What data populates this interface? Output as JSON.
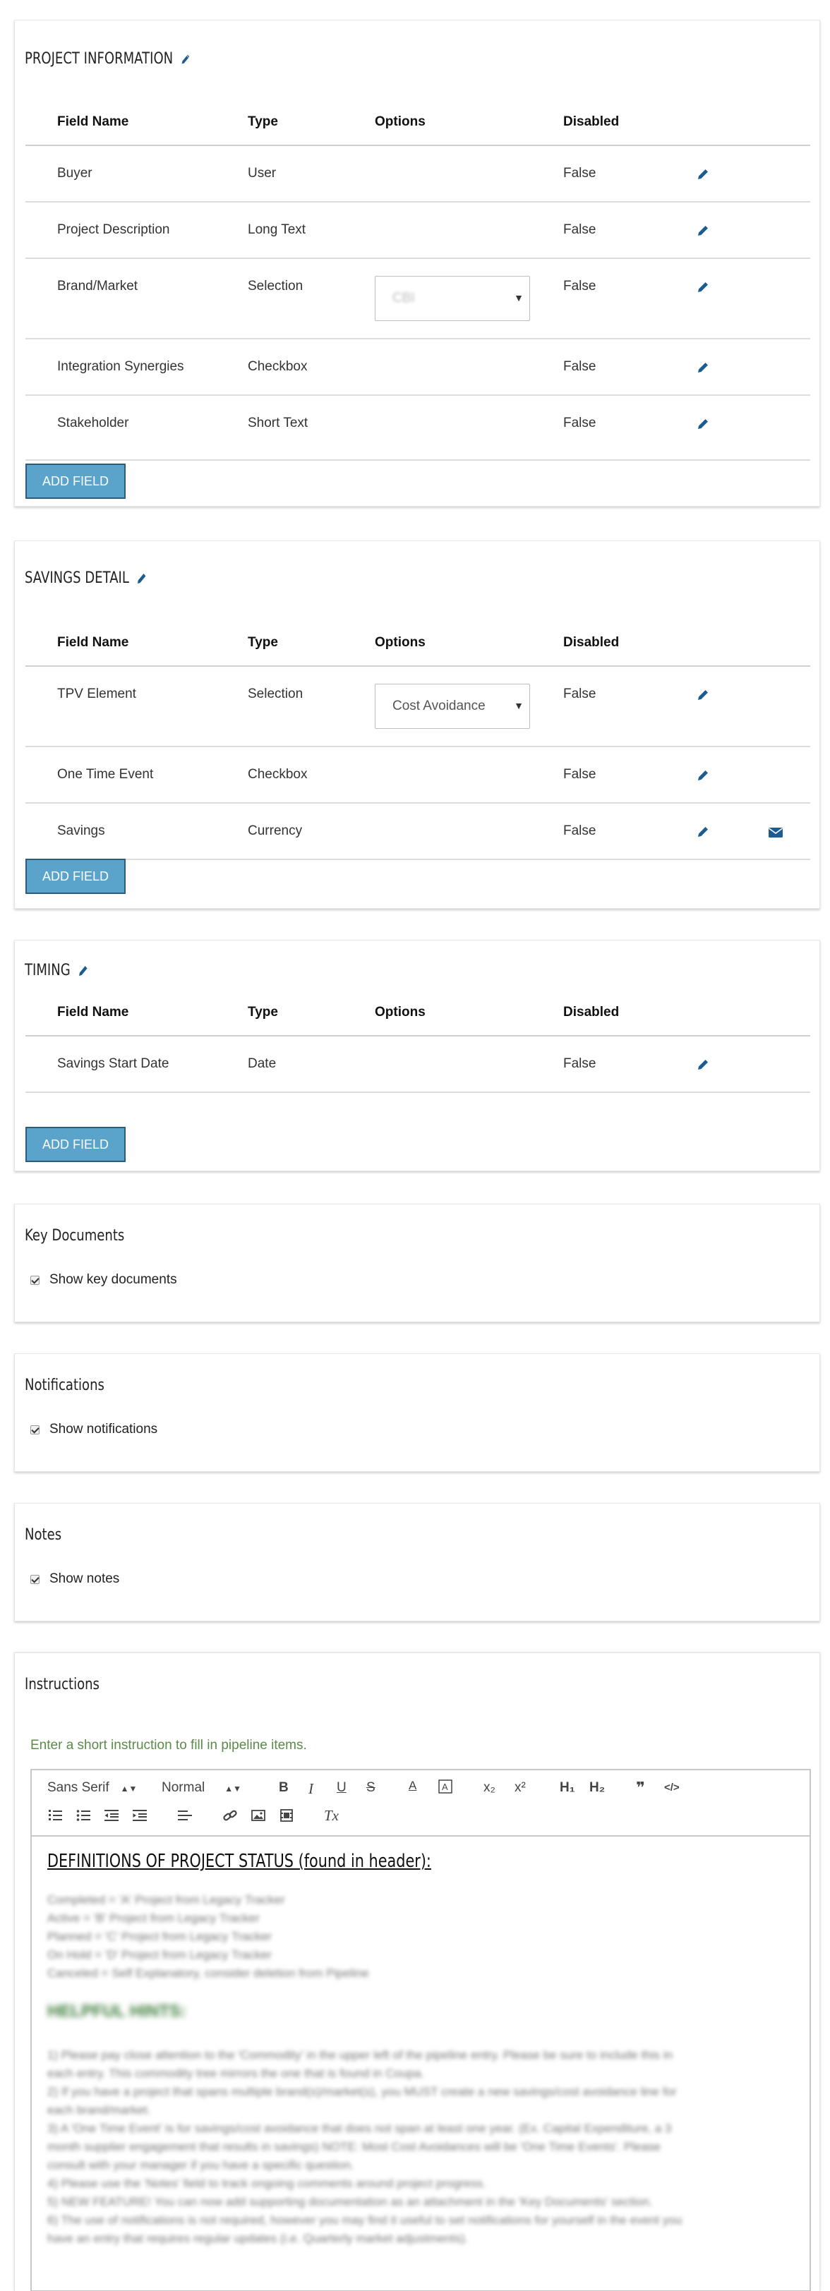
{
  "colors": {
    "accent_button": "#5aa4cb",
    "icon_blue": "#1d5c93",
    "hint_green": "#5b8a4a"
  },
  "table_headers": {
    "field_name": "Field Name",
    "type": "Type",
    "options": "Options",
    "disabled": "Disabled"
  },
  "project_information": {
    "title": "PROJECT INFORMATION",
    "add_label": "ADD FIELD",
    "rows": [
      {
        "name": "Buyer",
        "type": "User",
        "disabled": "False"
      },
      {
        "name": "Project Description",
        "type": "Long Text",
        "disabled": "False"
      },
      {
        "name": "Brand/Market",
        "type": "Selection",
        "option": "CBI",
        "disabled": "False"
      },
      {
        "name": "Integration Synergies",
        "type": "Checkbox",
        "disabled": "False"
      },
      {
        "name": "Stakeholder",
        "type": "Short Text",
        "disabled": "False"
      }
    ]
  },
  "savings_detail": {
    "title": "SAVINGS DETAIL",
    "add_label": "ADD FIELD",
    "rows": [
      {
        "name": "TPV Element",
        "type": "Selection",
        "option": "Cost Avoidance",
        "disabled": "False"
      },
      {
        "name": "One Time Event",
        "type": "Checkbox",
        "disabled": "False"
      },
      {
        "name": "Savings",
        "type": "Currency",
        "disabled": "False"
      }
    ]
  },
  "timing": {
    "title": "TIMING",
    "add_label": "ADD FIELD",
    "rows": [
      {
        "name": "Savings Start Date",
        "type": "Date",
        "disabled": "False"
      }
    ]
  },
  "key_documents": {
    "title": "Key Documents",
    "checkbox_label": "Show key documents",
    "checked": true
  },
  "notifications": {
    "title": "Notifications",
    "checkbox_label": "Show notifications",
    "checked": true
  },
  "notes": {
    "title": "Notes",
    "checkbox_label": "Show notes",
    "checked": true
  },
  "instructions": {
    "title": "Instructions",
    "hint": "Enter a short instruction to fill in pipeline items.",
    "toolbar": {
      "font": "Sans Serif",
      "size": "Normal",
      "bold": "B",
      "italic": "I",
      "underline": "U",
      "strike": "S",
      "color": "A",
      "subscript": "x₂",
      "superscript": "x²",
      "h1": "H₁",
      "h2": "H₂",
      "quote": "❞",
      "code": "</>",
      "clear": "Tx"
    },
    "content": {
      "heading": "DEFINITIONS OF PROJECT STATUS (found in header):",
      "status_lines": [
        "Completed = 'A' Project from Legacy Tracker",
        "Active = 'B' Project from Legacy Tracker",
        "Planned = 'C' Project from Legacy Tracker",
        "On Hold = 'D' Project from Legacy Tracker",
        "Canceled = Self Explanatory, consider deletion from Pipeline"
      ],
      "hints_heading": "HELPFUL HINTS:",
      "hint_lines": [
        "1) Please pay close attention to the 'Commodity' in the upper left of the pipeline entry. Please be sure to include this in",
        "each entry. This commodity tree mirrors the one that is found in Coupa.",
        "2) If you have a project that spans multiple brand(s)/market(s), you MUST create a new savings/cost avoidance line for",
        "each brand/market.",
        "3) A 'One Time Event' is for savings/cost avoidance that does not span at least one year. (Ex. Capital Expenditure, a 3",
        "month supplier engagement that results in savings) NOTE: Most Cost Avoidances will be 'One Time Events'. Please",
        "consult with your manager if you have a specific question.",
        "4) Please use the 'Notes' field to track ongoing comments around project progress.",
        "5) NEW FEATURE! You can now add supporting documentation as an attachment in the 'Key Documents' section.",
        "6) The use of notifications is not required, however you may find it useful to set notifications for yourself in the event you",
        "have an entry that requires regular updates (i.e. Quarterly market adjustments)."
      ]
    }
  }
}
